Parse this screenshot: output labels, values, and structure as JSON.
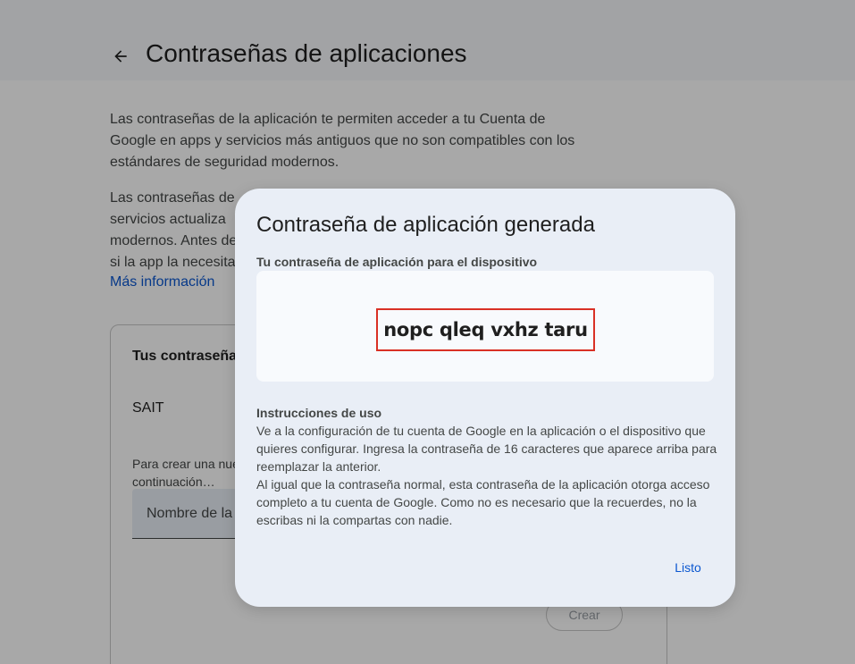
{
  "header": {
    "back_icon": "arrow-left-icon",
    "title": "Contraseñas de aplicaciones"
  },
  "intro": {
    "paragraph1": "Las contraseñas de la aplicación te permiten acceder a tu Cuenta de Google en apps y servicios más antiguos que no son compatibles con los estándares de seguridad modernos.",
    "paragraph2_lines": [
      "Las contraseñas de l",
      "servicios actualiza",
      "modernos. Antes de",
      "si la app la necesita"
    ],
    "more_info_link": "Más información"
  },
  "card": {
    "title": "Tus contraseña",
    "app_name": "SAIT",
    "hint": "Para crear una nue continuación…",
    "input_placeholder": "Nombre de la",
    "create_button": "Crear"
  },
  "dialog": {
    "title": "Contraseña de aplicación generada",
    "subtitle": "Tu contraseña de aplicación para el dispositivo",
    "password": "nopc qleq vxhz taru",
    "instructions_title": "Instrucciones de uso",
    "instructions_p1": "Ve a la configuración de tu cuenta de Google en la aplicación o el dispositivo que quieres configurar. Ingresa la contraseña de 16 caracteres que aparece arriba para reemplazar la anterior.",
    "instructions_p2": "Al igual que la contraseña normal, esta contraseña de la aplicación otorga acceso completo a tu cuenta de Google. Como no es necesario que la recuerdes, no la escribas ni la compartas con nadie.",
    "done_button": "Listo"
  },
  "colors": {
    "accent": "#0b57d0",
    "highlight_border": "#d93025",
    "dialog_bg": "#e9eef6"
  }
}
